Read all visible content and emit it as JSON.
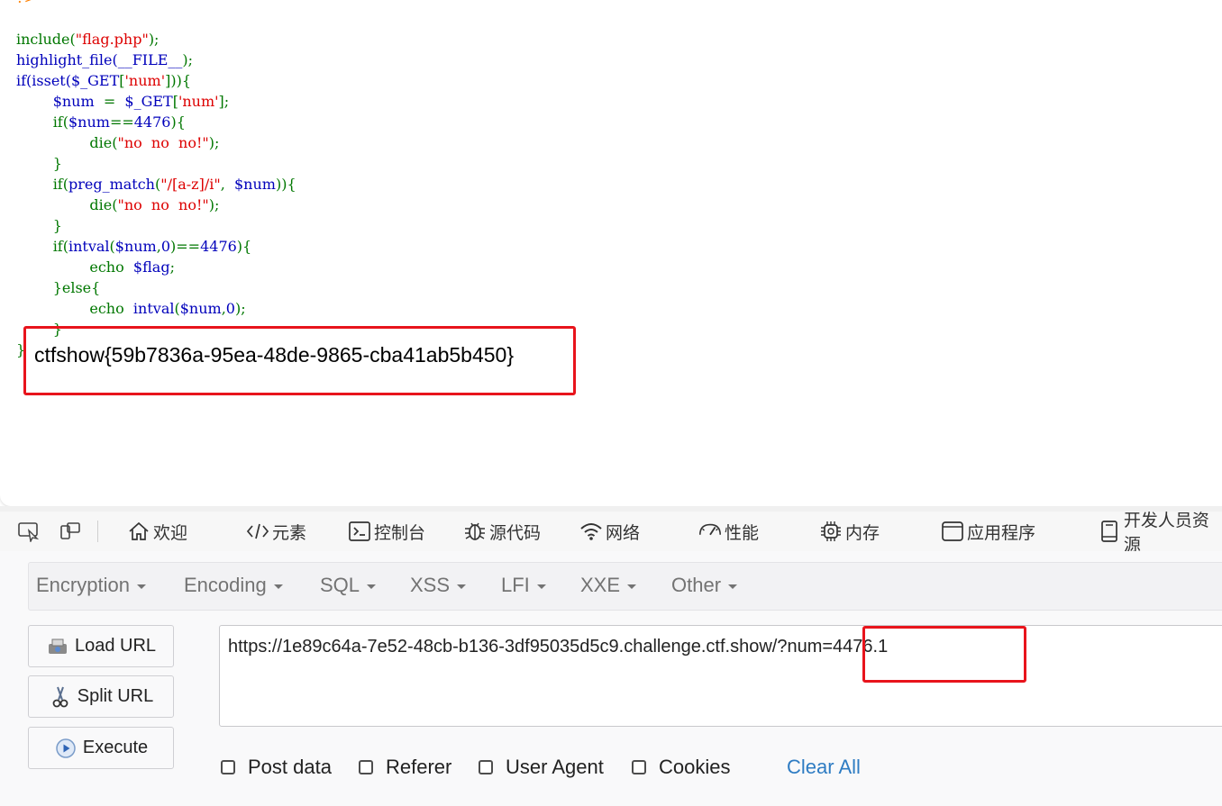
{
  "code": {
    "top_fragment": "?>",
    "lines": [
      {
        "segments": [
          {
            "t": "include(",
            "c": "kw"
          },
          {
            "t": "\"flag.php\"",
            "c": "str"
          },
          {
            "t": ");",
            "c": "kw"
          }
        ]
      },
      {
        "segments": [
          {
            "t": "highlight_file(",
            "c": "var"
          },
          {
            "t": "__FILE__",
            "c": "var"
          },
          {
            "t": ");",
            "c": "kw"
          }
        ]
      },
      {
        "segments": [
          {
            "t": "if(isset(",
            "c": "var"
          },
          {
            "t": "$_GET",
            "c": "var"
          },
          {
            "t": "[",
            "c": "kw"
          },
          {
            "t": "'num'",
            "c": "str"
          },
          {
            "t": "])){",
            "c": "kw"
          }
        ]
      },
      {
        "segments": [
          {
            "t": "        ",
            "c": "kw"
          },
          {
            "t": "$num ",
            "c": "var"
          },
          {
            "t": " = ",
            "c": "kw"
          },
          {
            "t": " $_GET",
            "c": "var"
          },
          {
            "t": "[",
            "c": "kw"
          },
          {
            "t": "'num'",
            "c": "str"
          },
          {
            "t": "];",
            "c": "kw"
          }
        ]
      },
      {
        "segments": [
          {
            "t": "        if(",
            "c": "kw"
          },
          {
            "t": "$num",
            "c": "var"
          },
          {
            "t": "==",
            "c": "kw"
          },
          {
            "t": "4476",
            "c": "var"
          },
          {
            "t": "){",
            "c": "kw"
          }
        ]
      },
      {
        "segments": [
          {
            "t": "                die(",
            "c": "kw"
          },
          {
            "t": "\"no  no  no!\"",
            "c": "str"
          },
          {
            "t": ");",
            "c": "kw"
          }
        ]
      },
      {
        "segments": [
          {
            "t": "        }",
            "c": "kw"
          }
        ]
      },
      {
        "segments": [
          {
            "t": "        if(",
            "c": "kw"
          },
          {
            "t": "preg_match",
            "c": "var"
          },
          {
            "t": "(",
            "c": "kw"
          },
          {
            "t": "\"/[a-z]/i\"",
            "c": "str"
          },
          {
            "t": ",  ",
            "c": "kw"
          },
          {
            "t": "$num",
            "c": "var"
          },
          {
            "t": ")){",
            "c": "kw"
          }
        ]
      },
      {
        "segments": [
          {
            "t": "                die(",
            "c": "kw"
          },
          {
            "t": "\"no  no  no!\"",
            "c": "str"
          },
          {
            "t": ");",
            "c": "kw"
          }
        ]
      },
      {
        "segments": [
          {
            "t": "        }",
            "c": "kw"
          }
        ]
      },
      {
        "segments": [
          {
            "t": "        if(",
            "c": "kw"
          },
          {
            "t": "intval",
            "c": "var"
          },
          {
            "t": "(",
            "c": "kw"
          },
          {
            "t": "$num",
            "c": "var"
          },
          {
            "t": ",",
            "c": "kw"
          },
          {
            "t": "0",
            "c": "var"
          },
          {
            "t": ")==",
            "c": "kw"
          },
          {
            "t": "4476",
            "c": "var"
          },
          {
            "t": "){",
            "c": "kw"
          }
        ]
      },
      {
        "segments": [
          {
            "t": "                echo  ",
            "c": "kw"
          },
          {
            "t": "$flag",
            "c": "var"
          },
          {
            "t": ";",
            "c": "kw"
          }
        ]
      },
      {
        "segments": [
          {
            "t": "        }else{",
            "c": "kw"
          }
        ]
      },
      {
        "segments": [
          {
            "t": "                echo  ",
            "c": "kw"
          },
          {
            "t": "intval",
            "c": "var"
          },
          {
            "t": "(",
            "c": "kw"
          },
          {
            "t": "$num",
            "c": "var"
          },
          {
            "t": ",",
            "c": "kw"
          },
          {
            "t": "0",
            "c": "var"
          },
          {
            "t": ");",
            "c": "kw"
          }
        ]
      },
      {
        "segments": [
          {
            "t": "        }",
            "c": "kw"
          }
        ]
      },
      {
        "segments": [
          {
            "t": "}",
            "c": "kw"
          }
        ]
      }
    ]
  },
  "flag_output": "ctfshow{59b7836a-95ea-48de-9865-cba41ab5b450}",
  "devtools": {
    "tabs": [
      {
        "label": "欢迎",
        "icon": "home-icon"
      },
      {
        "label": "元素",
        "icon": "code-icon"
      },
      {
        "label": "控制台",
        "icon": "console-icon"
      },
      {
        "label": "源代码",
        "icon": "bug-icon"
      },
      {
        "label": "网络",
        "icon": "wifi-icon"
      },
      {
        "label": "性能",
        "icon": "gauge-icon"
      },
      {
        "label": "内存",
        "icon": "chip-icon"
      },
      {
        "label": "应用程序",
        "icon": "window-icon"
      },
      {
        "label": "开发人员资源",
        "icon": "book-icon"
      }
    ]
  },
  "hackbar": {
    "menu": [
      "Encryption",
      "Encoding",
      "SQL",
      "XSS",
      "LFI",
      "XXE",
      "Other"
    ],
    "buttons": {
      "load": "Load URL",
      "split": "Split URL",
      "execute": "Execute"
    },
    "url": {
      "base": "https://1e89c64a-7e52-48cb-b136-3df95035d5c9.challenge.ctf.show/",
      "query": "?num=4476.1"
    },
    "options": [
      "Post data",
      "Referer",
      "User Agent",
      "Cookies"
    ],
    "clear_all": "Clear All"
  },
  "colors": {
    "highlight_box": "#e8141c",
    "link": "#2e7cc3",
    "php_keyword": "#007700",
    "php_var": "#0000BB",
    "php_string": "#DD0000"
  }
}
